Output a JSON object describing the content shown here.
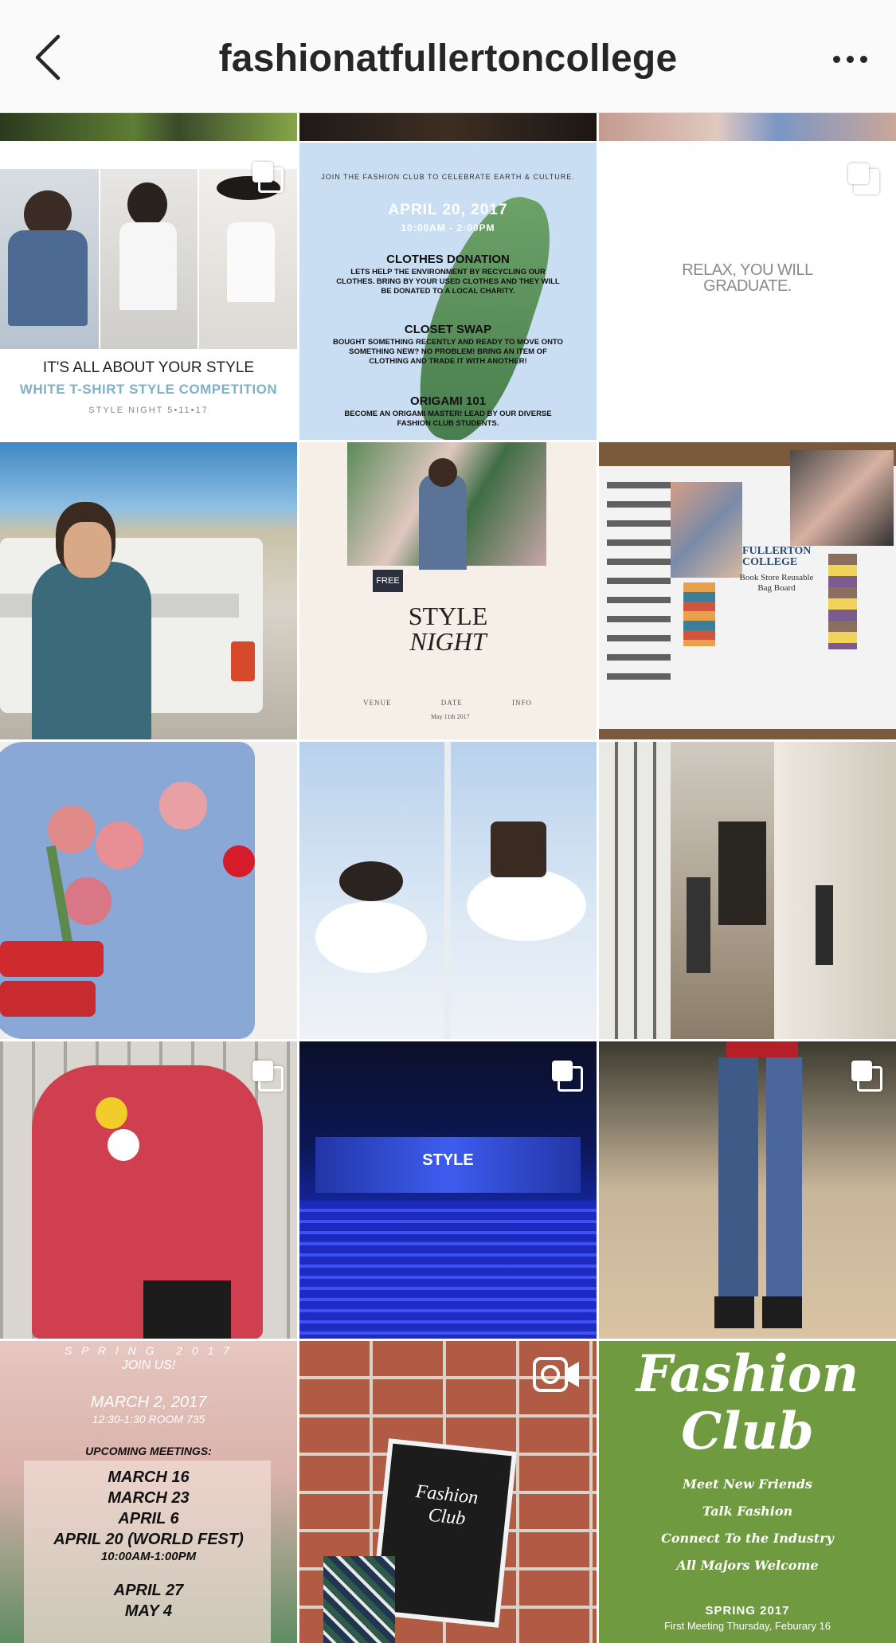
{
  "header": {
    "title": "fashionatfullertoncollege"
  },
  "posts": {
    "style_competition": {
      "headline": "IT'S ALL ABOUT YOUR STYLE",
      "subheadline": "WHITE T-SHIRT STYLE COMPETITION",
      "footer": "STYLE NIGHT 5•11•17"
    },
    "worldfest": {
      "intro": "JOIN THE FASHION CLUB TO CELEBRATE EARTH & CULTURE.",
      "date": "APRIL 20, 2017",
      "time": "10:00AM - 2:00PM",
      "h1": "CLOTHES DONATION",
      "p1": "LETS HELP THE ENVIRONMENT BY RECYCLING OUR CLOTHES. BRING BY YOUR USED CLOTHES AND THEY WILL BE DONATED TO A LOCAL CHARITY.",
      "h2": "CLOSET SWAP",
      "p2": "BOUGHT SOMETHING RECENTLY AND READY TO MOVE ONTO SOMETHING NEW? NO PROBLEM! BRING AN ITEM OF CLOTHING AND TRADE IT WITH ANOTHER!",
      "h3": "ORIGAMI 101",
      "p3": "BECOME AN ORIGAMI MASTER! LEAD BY OUR DIVERSE FASHION CLUB STUDENTS."
    },
    "relax": {
      "text": "RELAX, YOU WILL GRADUATE."
    },
    "style_night": {
      "badge": "FREE",
      "title1": "STYLE",
      "title2": "NIGHT",
      "cols": [
        "VENUE",
        "DATE",
        "INFO"
      ],
      "date_val": "May 11th 2017"
    },
    "bag_board": {
      "college": "FULLERTON COLLEGE",
      "caption": "Book Store Reusable Bag Board"
    },
    "stage": {
      "label": "STYLE"
    },
    "spring_schedule": {
      "line1": "S P R I N G   2 0 1 7",
      "line2": "JOIN US!",
      "date": "MARCH 2, 2017",
      "time": "12:30-1:30 ROOM 735",
      "upcoming": "UPCOMING MEETINGS:",
      "dates": [
        "MARCH 16",
        "MARCH 23",
        "APRIL 6",
        "APRIL 20 (WORLD FEST)",
        "10:00AM-1:00PM",
        "APRIL 27",
        "MAY 4"
      ]
    },
    "flyer": {
      "title1": "Fashion",
      "title2": "Club"
    },
    "fashion_club": {
      "title1": "Fashion",
      "title2": "Club",
      "lines": [
        "Meet New Friends",
        "Talk Fashion",
        "Connect To the Industry",
        "All Majors Welcome"
      ],
      "season": "SPRING 2017",
      "first_meeting": "First Meeting Thursday, Feburary 16"
    }
  },
  "icons": [
    "back-arrow-icon",
    "more-icon",
    "multi-photo-icon",
    "video-camera-icon"
  ],
  "colors": {
    "header_bg": "#fafafa",
    "text": "#262626",
    "green_post": "#6f9a3f",
    "blue_post": "#c9def3"
  }
}
